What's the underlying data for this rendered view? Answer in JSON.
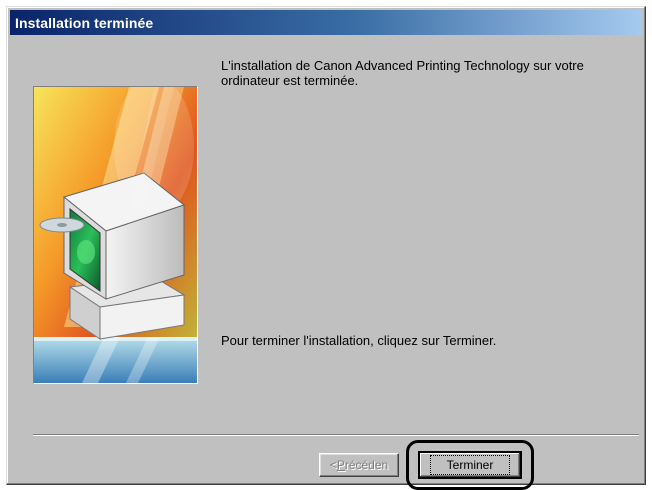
{
  "window": {
    "title": "Installation terminée"
  },
  "content": {
    "message_main": "L'installation de Canon Advanced Printing Technology sur votre ordinateur est terminée.",
    "message_instruction": "Pour terminer l'installation, cliquez sur Terminer."
  },
  "buttons": {
    "back_prefix": "< ",
    "back_mnemonic": "P",
    "back_rest": "récéden",
    "finish_label": "Terminer"
  },
  "colors": {
    "titlebar_start": "#0a246a",
    "titlebar_end": "#a6caf0",
    "dialog_face": "#c0c0c0"
  },
  "icons": {
    "wizard_art": "computer-install-illustration"
  }
}
